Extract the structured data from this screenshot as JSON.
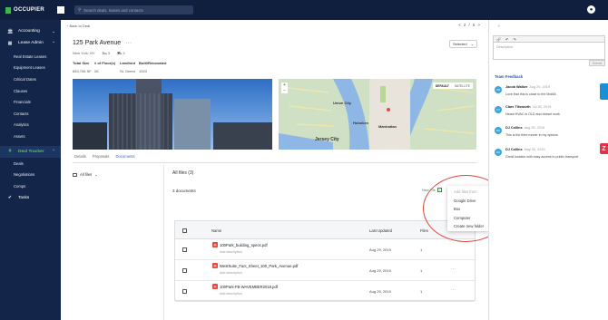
{
  "app": {
    "name": "OCCUPIER"
  },
  "search": {
    "placeholder": "Search deals, leases and contacts"
  },
  "sidebar": {
    "items": [
      {
        "label": "Accounting",
        "icon": "bank-icon"
      },
      {
        "label": "Lease Admin",
        "icon": "grid-icon"
      }
    ],
    "lease_admin_sub": [
      "Real Estate Leases",
      "Equipment Leases",
      "Critical Dates",
      "Clauses",
      "Financials",
      "Contacts",
      "Analytics",
      "Assets"
    ],
    "deal_tracker": {
      "label": "Deal Tracker",
      "icon": "handshake-icon"
    },
    "deal_tracker_sub": [
      "Deals",
      "Negotiations",
      "Comps"
    ],
    "tasks": {
      "label": "Tasks",
      "icon": "check-circle-icon"
    }
  },
  "header": {
    "back": "Back to Deal",
    "pager": "< 2 / 5 >"
  },
  "property": {
    "title": "125 Park Avenue",
    "more": "···",
    "location": "New York, NY",
    "beds": "3",
    "parking": "3",
    "status_select": "Selected",
    "meta_labels": [
      "Total Size",
      "# of Floor(s)",
      "Landlord",
      "Built/Renovated"
    ],
    "meta_values": [
      "653,706 SF",
      "26",
      "SL Green",
      "1923"
    ]
  },
  "map": {
    "type_options": [
      "DEFAULT",
      "SATELLITE"
    ],
    "city_label": "Jersey City",
    "place_labels": [
      "Union City",
      "Hoboken",
      "Manhattan"
    ]
  },
  "tabs": [
    "Details",
    "Proposals",
    "Documents"
  ],
  "files": {
    "left_filter": "All files",
    "title": "All files (3)",
    "doc_count": "3 documents",
    "new_file_label": "New File",
    "columns": {
      "name": "Name",
      "updated": "Last Updated",
      "size": "Files"
    },
    "rows": [
      {
        "name": "100Park_building_specs.pdf",
        "desc": "Add description",
        "updated": "Aug 29, 2019",
        "size": "1"
      },
      {
        "name": "WestSuite_Fact_Sheet_100_Park_Avenue.pdf",
        "desc": "Add description",
        "updated": "Aug 29, 2019",
        "size": "1"
      },
      {
        "name": "100Park-FB-WAVEMBER2018.pdf",
        "desc": "Add description",
        "updated": "Aug 29, 2019",
        "size": "1"
      }
    ],
    "more": "···"
  },
  "add_files_menu": {
    "header": "Add files from",
    "options": [
      "Google Drive",
      "Box",
      "Computer",
      "Create new folder"
    ]
  },
  "right_panel": {
    "description_placeholder": "Description",
    "submit": "Submit",
    "team_feedback_title": "Team Feedback",
    "feedback": [
      {
        "initials": "JW",
        "name": "Jacob Walker",
        "date": "Aug 29, 2019",
        "text": "Love that this is close to the MoMA"
      },
      {
        "initials": "CT",
        "name": "Clare Titsworth",
        "date": "Jul 30, 2019",
        "text": "Heard HVAC is OLD and doesnt work"
      },
      {
        "initials": "DC",
        "name": "DJ Collins",
        "date": "Aug 30, 2019",
        "text": "This is the third runner in my opinion"
      },
      {
        "initials": "DC",
        "name": "DJ Collins",
        "date": "May 30, 2019",
        "text": "Great location with easy access to public transport"
      }
    ]
  },
  "colors": {
    "sidebar_bg": "#13264a",
    "accent_green": "#3fb54e",
    "link_blue": "#2b6cd1",
    "highlight_red": "#e0463a"
  }
}
